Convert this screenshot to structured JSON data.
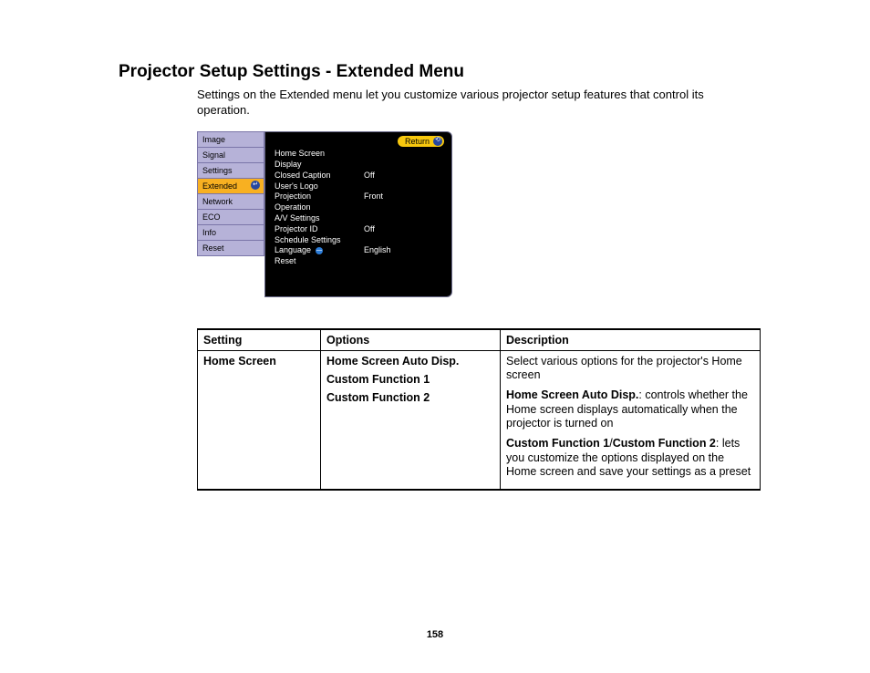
{
  "title": "Projector Setup Settings - Extended Menu",
  "intro": "Settings on the Extended menu let you customize various projector setup features that control its operation.",
  "osd": {
    "sidebar": [
      {
        "label": "Image",
        "active": false
      },
      {
        "label": "Signal",
        "active": false
      },
      {
        "label": "Settings",
        "active": false
      },
      {
        "label": "Extended",
        "active": true
      },
      {
        "label": "Network",
        "active": false
      },
      {
        "label": "ECO",
        "active": false
      },
      {
        "label": "Info",
        "active": false
      },
      {
        "label": "Reset",
        "active": false
      }
    ],
    "return_label": "Return",
    "rows": [
      {
        "label": "Home Screen",
        "value": ""
      },
      {
        "label": "Display",
        "value": ""
      },
      {
        "label": "Closed Caption",
        "value": "Off"
      },
      {
        "label": "User's Logo",
        "value": ""
      },
      {
        "label": "Projection",
        "value": "Front"
      },
      {
        "label": "Operation",
        "value": ""
      },
      {
        "label": "A/V Settings",
        "value": ""
      },
      {
        "label": "Projector ID",
        "value": "Off"
      },
      {
        "label": "Schedule Settings",
        "value": ""
      },
      {
        "label": "Language",
        "value": "English",
        "has_lang_icon": true
      },
      {
        "label": "Reset",
        "value": ""
      }
    ]
  },
  "table": {
    "headers": {
      "setting": "Setting",
      "options": "Options",
      "description": "Description"
    },
    "row": {
      "setting": "Home Screen",
      "options": [
        "Home Screen Auto Disp.",
        "Custom Function 1",
        "Custom Function 2"
      ],
      "desc": {
        "p1": "Select various options for the projector's Home screen",
        "p2_b": "Home Screen Auto Disp.",
        "p2_rest": ": controls whether the Home screen displays automatically when the projector is turned on",
        "p3_b1": "Custom Function 1",
        "p3_slash": "/",
        "p3_b2": "Custom Function 2",
        "p3_rest": ": lets you customize the options displayed on the Home screen and save your settings as a preset"
      }
    }
  },
  "page_number": "158"
}
